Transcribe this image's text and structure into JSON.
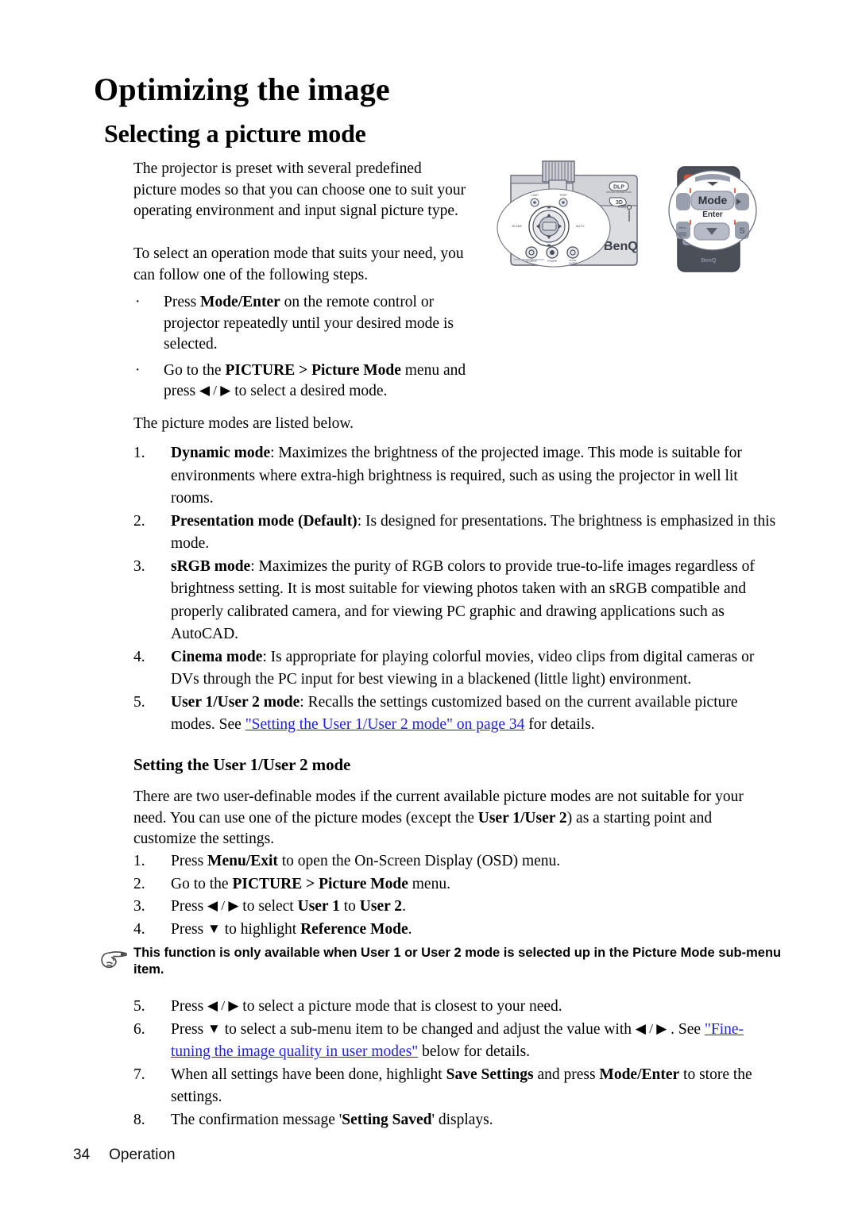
{
  "document": {
    "title": "Optimizing the image",
    "section_heading": "Selecting a picture mode",
    "subsection_heading": "Setting the User 1/User 2 mode"
  },
  "intro": {
    "paragraph_1": "The projector is preset with several predefined picture modes so that you can choose one to suit your operating environment and input signal picture type.",
    "paragraph_2": "To select an operation mode that suits your need, you can follow one of the following steps."
  },
  "bullets": [
    {
      "marker": "·",
      "parts": [
        {
          "text": "Press ",
          "style": "normal"
        },
        {
          "text": "Mode/Enter",
          "style": "bold"
        },
        {
          "text": " on the remote control or projector repeatedly until your desired mode is selected.",
          "style": "normal"
        }
      ]
    },
    {
      "marker": "·",
      "parts": [
        {
          "text": "Go to the ",
          "style": "normal"
        },
        {
          "text": "PICTURE > Picture Mode",
          "style": "bold"
        },
        {
          "text": " menu and press ",
          "style": "normal"
        },
        {
          "text": "◀ / ▶",
          "style": "arrow"
        },
        {
          "text": " to select a desired mode.",
          "style": "normal"
        }
      ]
    }
  ],
  "lead_in": "The picture modes are listed below.",
  "picture_modes": [
    {
      "number": "1.",
      "name": "Dynamic mode",
      "body": ": Maximizes the brightness of the projected image. This mode is suitable for environments where extra-high brightness is required, such as using the projector in well lit rooms."
    },
    {
      "number": "2.",
      "name": "Presentation mode (Default)",
      "body": ": Is designed for presentations. The brightness is emphasized in this mode."
    },
    {
      "number": "3.",
      "name": "sRGB mode",
      "body": ": Maximizes the purity of RGB colors to provide true-to-life images regardless of brightness setting. It is most suitable for viewing photos taken with an sRGB compatible and properly calibrated camera, and for viewing PC graphic and drawing applications such as AutoCAD."
    },
    {
      "number": "4.",
      "name": "Cinema mode",
      "body": ":  Is appropriate for playing colorful movies, video clips from digital cameras or DVs through the PC input for best viewing in a blackened (little light) environment."
    },
    {
      "number": "5.",
      "name": "User 1/User 2 mode",
      "body": ": Recalls the settings customized based on the current available picture modes. See ",
      "link_text": "\"Setting the User 1/User 2 mode\" on page 34",
      "body_after": " for details."
    }
  ],
  "user_mode_intro": {
    "part_1": "There are two user-definable modes if the current available picture modes are not suitable for your need. You can use one of the picture modes (except the ",
    "bold_1": "User 1/User 2",
    "part_2": ") as a starting point and customize the settings."
  },
  "steps_a": [
    {
      "number": "1.",
      "parts": [
        {
          "text": "Press ",
          "style": "normal"
        },
        {
          "text": "Menu/Exit",
          "style": "bold"
        },
        {
          "text": " to open the On-Screen Display (OSD) menu.",
          "style": "normal"
        }
      ]
    },
    {
      "number": "2.",
      "parts": [
        {
          "text": "Go to the ",
          "style": "normal"
        },
        {
          "text": "PICTURE > Picture Mode",
          "style": "bold"
        },
        {
          "text": " menu.",
          "style": "normal"
        }
      ]
    },
    {
      "number": "3.",
      "parts": [
        {
          "text": "Press ",
          "style": "normal"
        },
        {
          "text": "◀ / ▶",
          "style": "arrow"
        },
        {
          "text": " to select ",
          "style": "normal"
        },
        {
          "text": "User 1",
          "style": "bold"
        },
        {
          "text": " to ",
          "style": "normal"
        },
        {
          "text": "User 2",
          "style": "bold"
        },
        {
          "text": ".",
          "style": "normal"
        }
      ]
    },
    {
      "number": "4.",
      "parts": [
        {
          "text": "Press ",
          "style": "normal"
        },
        {
          "text": "▼",
          "style": "arrow"
        },
        {
          "text": " to highlight ",
          "style": "normal"
        },
        {
          "text": "Reference Mode",
          "style": "bold"
        },
        {
          "text": ".",
          "style": "normal"
        }
      ]
    }
  ],
  "note": {
    "icon": "pointing-hand-icon",
    "text": "This function is only available when User 1 or User 2 mode is selected up in the Picture Mode sub-menu item."
  },
  "steps_b": [
    {
      "number": "5.",
      "parts": [
        {
          "text": "Press ",
          "style": "normal"
        },
        {
          "text": "◀ / ▶",
          "style": "arrow"
        },
        {
          "text": " to select a picture mode that is closest to your need.",
          "style": "normal"
        }
      ]
    },
    {
      "number": "6.",
      "parts": [
        {
          "text": "Press ",
          "style": "normal"
        },
        {
          "text": "▼",
          "style": "arrow"
        },
        {
          "text": " to select a sub-menu item to be changed and adjust the value with ",
          "style": "normal"
        },
        {
          "text": "◀ / ▶",
          "style": "arrow"
        },
        {
          "text": " . See ",
          "style": "normal"
        },
        {
          "text": "\"Fine-tuning the image quality in user modes\"",
          "style": "link"
        },
        {
          "text": " below for details.",
          "style": "normal"
        }
      ]
    },
    {
      "number": "7.",
      "parts": [
        {
          "text": "When all settings have been done, highlight ",
          "style": "normal"
        },
        {
          "text": "Save Settings",
          "style": "bold"
        },
        {
          "text": " and press ",
          "style": "normal"
        },
        {
          "text": "Mode/Enter",
          "style": "bold"
        },
        {
          "text": " to store the settings.",
          "style": "normal"
        }
      ]
    },
    {
      "number": "8.",
      "parts": [
        {
          "text": "The confirmation message '",
          "style": "normal"
        },
        {
          "text": "Setting Saved",
          "style": "bold"
        },
        {
          "text": "' displays.",
          "style": "normal"
        }
      ]
    }
  ],
  "footer": {
    "page_number": "34",
    "section": "Operation"
  },
  "figures": {
    "projector": {
      "name": "projector-top-view-illustration",
      "brand": "BenQ",
      "badge_1": "DLP",
      "badge_2": "3D",
      "button_labels": [
        "LAMP",
        "TEMP",
        "BLANK",
        "AUTO",
        "SOURCE",
        "POWER",
        "MODE ENTER"
      ]
    },
    "remote": {
      "name": "remote-control-illustration",
      "brand": "BenQ",
      "callout_main": "Mode",
      "callout_sub": "Enter",
      "side_button": "S"
    }
  },
  "colors": {
    "link": "#2222dd",
    "body_text": "#000000",
    "figure_body": "#d9dade",
    "figure_outline": "#5a5f6e",
    "figure_dark": "#4b4f58",
    "figure_accent": "#e2533a",
    "figure_button": "#8e93a3"
  }
}
